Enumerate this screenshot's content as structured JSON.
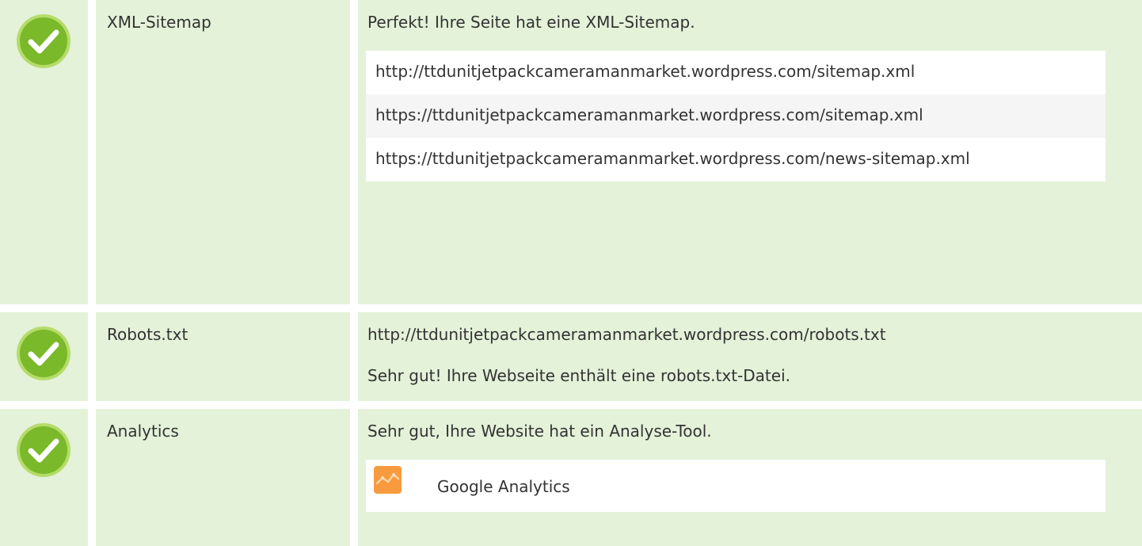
{
  "colors": {
    "row_background": "#e3f2d9",
    "check_fill": "#7ab929",
    "check_border": "#b5dc6a",
    "analytics_logo": "#f89b3e"
  },
  "rows": [
    {
      "status_icon": "check-circle-icon",
      "label": "XML-Sitemap",
      "message": "Perfekt! Ihre Seite hat eine XML-Sitemap.",
      "urls": [
        "http://ttdunitjetpackcameramanmarket.wordpress.com/sitemap.xml",
        "https://ttdunitjetpackcameramanmarket.wordpress.com/sitemap.xml",
        "https://ttdunitjetpackcameramanmarket.wordpress.com/news-sitemap.xml"
      ]
    },
    {
      "status_icon": "check-circle-icon",
      "label": "Robots.txt",
      "url": "http://ttdunitjetpackcameramanmarket.wordpress.com/robots.txt",
      "message": "Sehr gut! Ihre Webseite enthält eine robots.txt-Datei."
    },
    {
      "status_icon": "check-circle-icon",
      "label": "Analytics",
      "message": "Sehr gut, Ihre Website hat ein Analyse-Tool.",
      "tool": {
        "icon": "google-analytics-icon",
        "name": "Google Analytics"
      }
    }
  ]
}
